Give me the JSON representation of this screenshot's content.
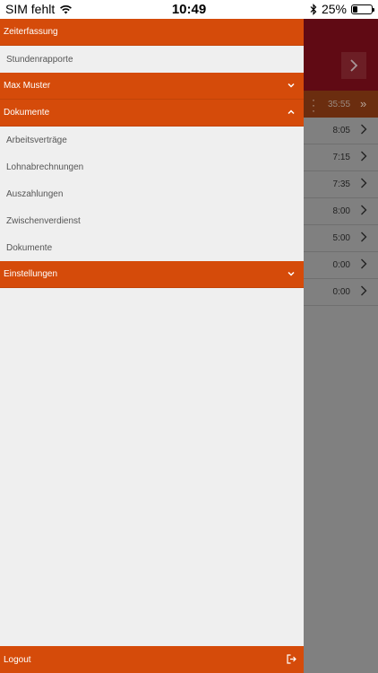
{
  "status_bar": {
    "carrier": "SIM fehlt",
    "time": "10:49",
    "battery": "25%",
    "battery_level": 0.25
  },
  "drawer": {
    "section_zeiterfassung": "Zeiterfassung",
    "item_stundenrapporte": "Stundenrapporte",
    "section_user": "Max Muster",
    "section_dokumente": "Dokumente",
    "dokumente_items": [
      "Arbeitsverträge",
      "Lohnabrechnungen",
      "Auszahlungen",
      "Zwischenverdienst",
      "Dokumente"
    ],
    "section_einstellungen": "Einstellungen",
    "logout": "Logout"
  },
  "background": {
    "total": "35:55",
    "rows": [
      "8:05",
      "7:15",
      "7:35",
      "8:00",
      "5:00",
      "0:00",
      "0:00"
    ]
  },
  "colors": {
    "accent": "#d54b0a",
    "header_bg": "#600a14"
  }
}
